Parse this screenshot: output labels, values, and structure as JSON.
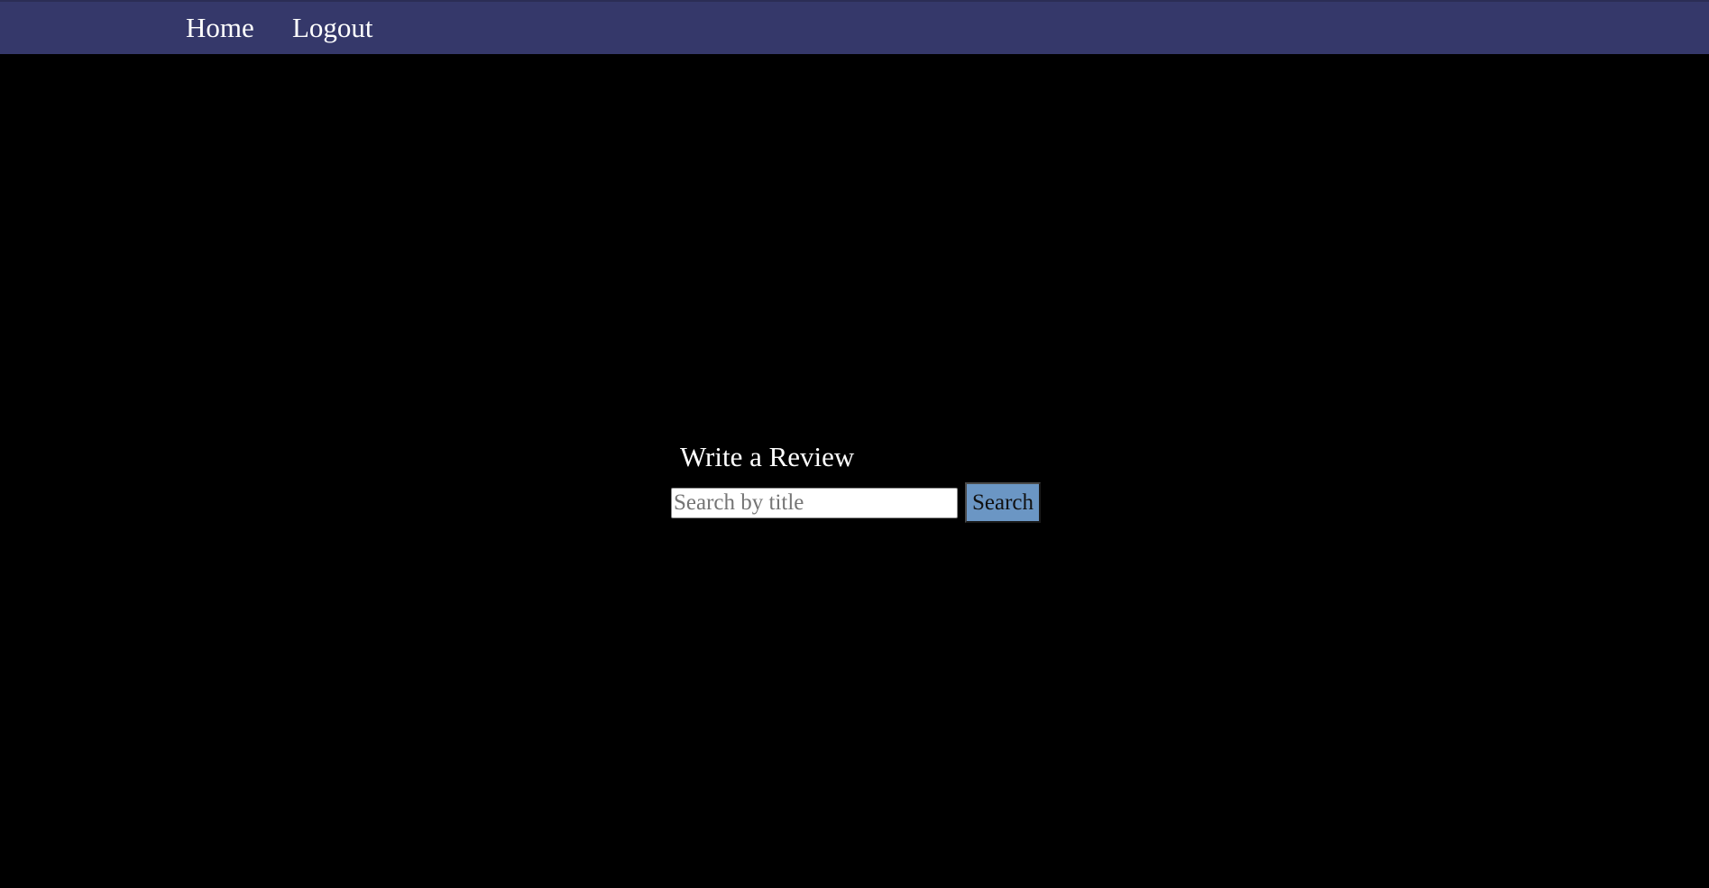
{
  "nav": {
    "home_label": "Home",
    "logout_label": "Logout",
    "background_color": "#35386a"
  },
  "main": {
    "heading": "Write a Review",
    "search": {
      "value": "",
      "placeholder": "Search by title"
    },
    "search_button_label": "Search",
    "search_button_color": "#6b96c4"
  },
  "page": {
    "background_color": "#000000"
  }
}
